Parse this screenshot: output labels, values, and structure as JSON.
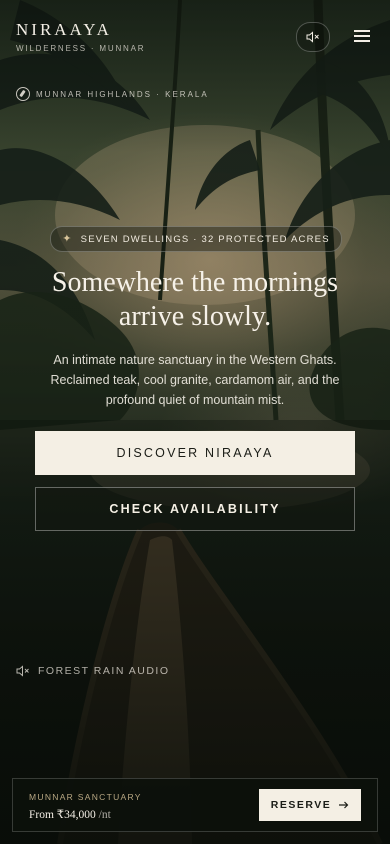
{
  "brand": {
    "name": "NIRAAYA",
    "subtitle": "WILDERNESS · MUNNAR"
  },
  "icons": {
    "mute": "volume-muted-icon",
    "menu": "hamburger-menu-icon",
    "location": "compass-icon",
    "badge": "sparkle-icon",
    "arrow": "arrow-right-icon"
  },
  "location": "MUNNAR HIGHLANDS · KERALA",
  "badge": "SEVEN DWELLINGS · 32 PROTECTED ACRES",
  "hero": {
    "headline": "Somewhere the mornings arrive slowly.",
    "lede": "An intimate nature sanctuary in the Western Ghats. Reclaimed teak, cool granite, cardamom air, and the profound quiet of mountain mist."
  },
  "buttons": {
    "primary": "DISCOVER NIRAAYA",
    "secondary": "CHECK AVAILABILITY"
  },
  "audio": {
    "label": "FOREST RAIN AUDIO"
  },
  "reserve_bar": {
    "title": "MUNNAR SANCTUARY",
    "price_prefix": "From ₹34,000",
    "price_unit": "/nt",
    "button": "RESERVE"
  },
  "colors": {
    "accent": "#f4efe4",
    "gold": "#b8a783",
    "dark": "#0d130e"
  }
}
